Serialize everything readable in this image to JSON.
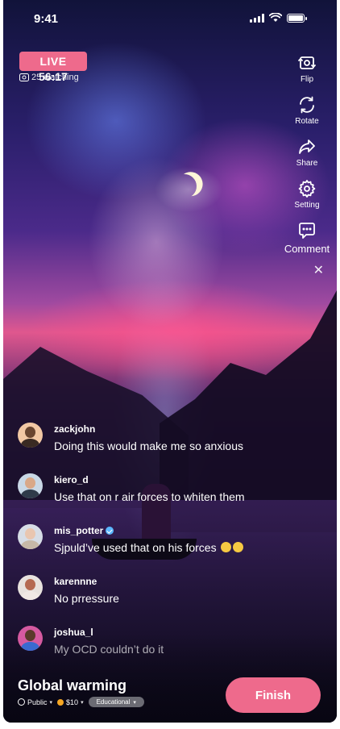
{
  "status_bar": {
    "time": "9:41"
  },
  "live": {
    "badge": "LIVE",
    "watching": "25 watching",
    "timer": "56:17"
  },
  "actions": [
    {
      "label": "Flip",
      "icon": "flip-camera-icon"
    },
    {
      "label": "Rotate",
      "icon": "rotate-icon"
    },
    {
      "label": "Share",
      "icon": "share-icon"
    },
    {
      "label": "Setting",
      "icon": "gear-icon"
    },
    {
      "label": "Comment",
      "icon": "comment-icon"
    }
  ],
  "comments": [
    {
      "user": "zackjohn",
      "text": "Doing this would make me so anxious",
      "verified": false
    },
    {
      "user": "kiero_d",
      "text": "Use that on r air forces to whiten them",
      "verified": false
    },
    {
      "user": "mis_potter",
      "text": "Sjpuld’ve used that on his forces",
      "verified": true
    },
    {
      "user": "karennne",
      "text": "No prressure",
      "verified": false
    },
    {
      "user": "joshua_l",
      "text": "My OCD couldn’t do it",
      "verified": false
    }
  ],
  "stream": {
    "title": "Global warming",
    "visibility": "Public",
    "price": "$10",
    "category": "Educational"
  },
  "finish_label": "Finish"
}
